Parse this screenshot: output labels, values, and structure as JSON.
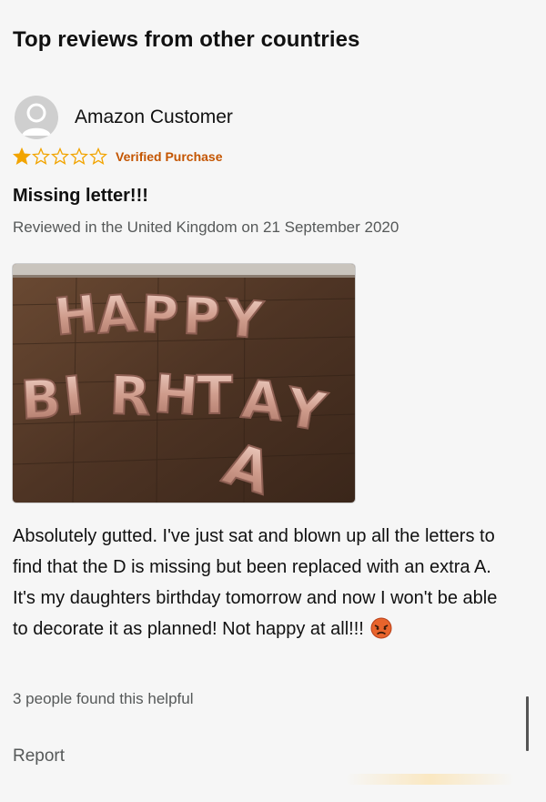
{
  "section": {
    "title": "Top reviews from other countries"
  },
  "review": {
    "reviewer_name": "Amazon Customer",
    "rating": 1,
    "max_rating": 5,
    "star_color": "#f2a400",
    "badge": "Verified Purchase",
    "title": "Missing letter!!!",
    "meta": "Reviewed in the United Kingdom on 21 September 2020",
    "image": {
      "letters_line1": [
        "H",
        "A",
        "P",
        "P",
        "Y"
      ],
      "letters_line2": [
        "B",
        "I",
        "R",
        "H",
        "T",
        "A",
        "Y"
      ],
      "letters_line3": [
        "A"
      ]
    },
    "body": "Absolutely gutted. I've just sat and blown up all the letters to find that the D is missing but been replaced with an extra A. It's my daughters birthday tomorrow and now I won't be able to decorate it as planned! Not happy at all!!!",
    "emoji": "angry-face-icon",
    "helpful": "3 people found this helpful",
    "report_label": "Report"
  },
  "colors": {
    "badge": "#c45500",
    "meta_text": "#565959",
    "balloon": "#d9a89a"
  }
}
